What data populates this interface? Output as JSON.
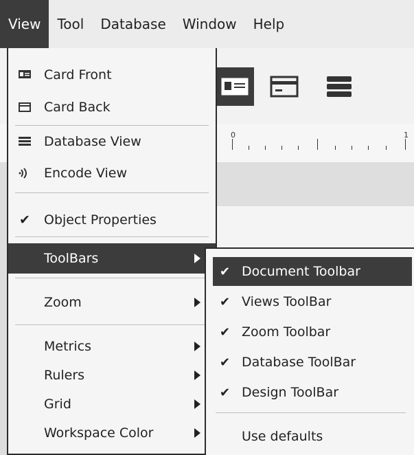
{
  "menubar": {
    "items": [
      "View",
      "Tool",
      "Database",
      "Window",
      "Help"
    ]
  },
  "ruler": {
    "labels": [
      "0",
      "1"
    ]
  },
  "view_menu": {
    "items": [
      {
        "label": "Card Front",
        "icon": "card-front-icon"
      },
      {
        "label": "Card Back",
        "icon": "card-back-icon"
      },
      {
        "label": "Database View",
        "icon": "database-view-icon"
      },
      {
        "label": "Encode View",
        "icon": "encode-view-icon"
      },
      {
        "label": "Object Properties",
        "checked": true
      },
      {
        "label": "ToolBars",
        "submenu": true,
        "highlighted": true
      },
      {
        "label": "Zoom",
        "submenu": true
      },
      {
        "label": "Metrics",
        "submenu": true
      },
      {
        "label": "Rulers",
        "submenu": true
      },
      {
        "label": "Grid",
        "submenu": true
      },
      {
        "label": "Workspace Color",
        "submenu": true
      }
    ],
    "check_glyph": "✔"
  },
  "toolbars_submenu": {
    "items": [
      {
        "label": "Document Toolbar",
        "checked": true,
        "highlighted": true
      },
      {
        "label": "Views ToolBar",
        "checked": true
      },
      {
        "label": "Zoom Toolbar",
        "checked": true
      },
      {
        "label": "Database ToolBar",
        "checked": true
      },
      {
        "label": "Design ToolBar",
        "checked": true
      },
      {
        "label": "Use defaults",
        "checked": false
      }
    ],
    "check_glyph": "✔"
  },
  "colors": {
    "highlight": "#3c3c3c",
    "menu_bg": "#f5f5f5"
  }
}
